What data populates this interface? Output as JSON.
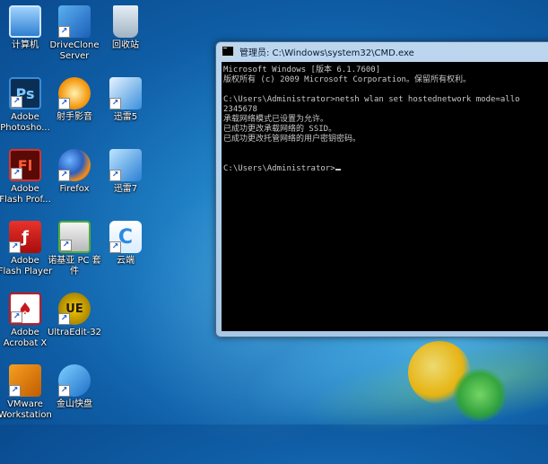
{
  "desktop": {
    "icons": [
      {
        "id": "computer",
        "label": "计算机"
      },
      {
        "id": "driveclone",
        "label": "DriveClone\nServer"
      },
      {
        "id": "recycle",
        "label": "回收站"
      },
      {
        "id": "photoshop",
        "label": "Adobe\nPhotosho..."
      },
      {
        "id": "player",
        "label": "射手影音"
      },
      {
        "id": "xunlei5",
        "label": "迅雷5"
      },
      {
        "id": "flashpro",
        "label": "Adobe\nFlash Prof..."
      },
      {
        "id": "firefox",
        "label": "Firefox"
      },
      {
        "id": "xunlei7",
        "label": "迅雷7"
      },
      {
        "id": "flashplayer",
        "label": "Adobe\nFlash Player"
      },
      {
        "id": "nokia",
        "label": "诺基亚 PC 套\n件"
      },
      {
        "id": "cloud",
        "label": "云端"
      },
      {
        "id": "acrobat",
        "label": "Adobe\nAcrobat X"
      },
      {
        "id": "ultraedit",
        "label": "UltraEdit-32"
      },
      {
        "id": "vmware",
        "label": "VMware\nWorkstation"
      },
      {
        "id": "kingsoft",
        "label": "金山快盘"
      }
    ],
    "glyphs": {
      "photoshop": "Ps",
      "flashpro": "Fl",
      "ultraedit": "UE",
      "cloud": "C"
    }
  },
  "cmd": {
    "title": "管理员: C:\\Windows\\system32\\CMD.exe",
    "lines": [
      "Microsoft Windows [版本 6.1.7600]",
      "版权所有 (c) 2009 Microsoft Corporation。保留所有权利。",
      "",
      "C:\\Users\\Administrator>netsh wlan set hostednetwork mode=allo",
      "2345678",
      "承载网络模式已设置为允许。",
      "已成功更改承载网络的 SSID。",
      "已成功更改托管网络的用户密钥密码。",
      "",
      "",
      "C:\\Users\\Administrator>"
    ]
  }
}
